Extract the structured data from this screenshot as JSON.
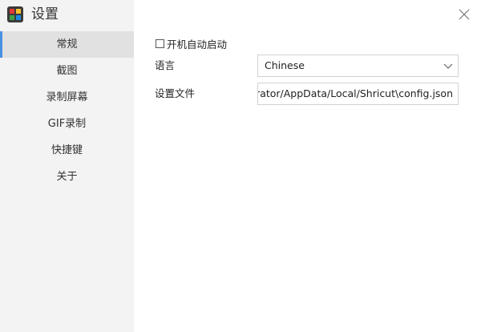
{
  "app": {
    "title": "设置",
    "logo_icon": "app-logo-icon"
  },
  "sidebar": {
    "items": [
      {
        "label": "常规",
        "active": true
      },
      {
        "label": "截图",
        "active": false
      },
      {
        "label": "录制屏幕",
        "active": false
      },
      {
        "label": "GIF录制",
        "active": false
      },
      {
        "label": "快捷键",
        "active": false
      },
      {
        "label": "关于",
        "active": false
      }
    ]
  },
  "general": {
    "autostart_label": "开机自动启动",
    "autostart_checked": false,
    "language_label": "语言",
    "language_value": "Chinese",
    "settings_file_label": "设置文件",
    "settings_file_value": "C:/Users/Administrator/AppData/Local/Shricut\\config.json"
  },
  "colors": {
    "sidebar_bg": "#f3f3f3",
    "active_item_bg": "#e1e1e1",
    "active_indicator": "#4a90e2"
  }
}
